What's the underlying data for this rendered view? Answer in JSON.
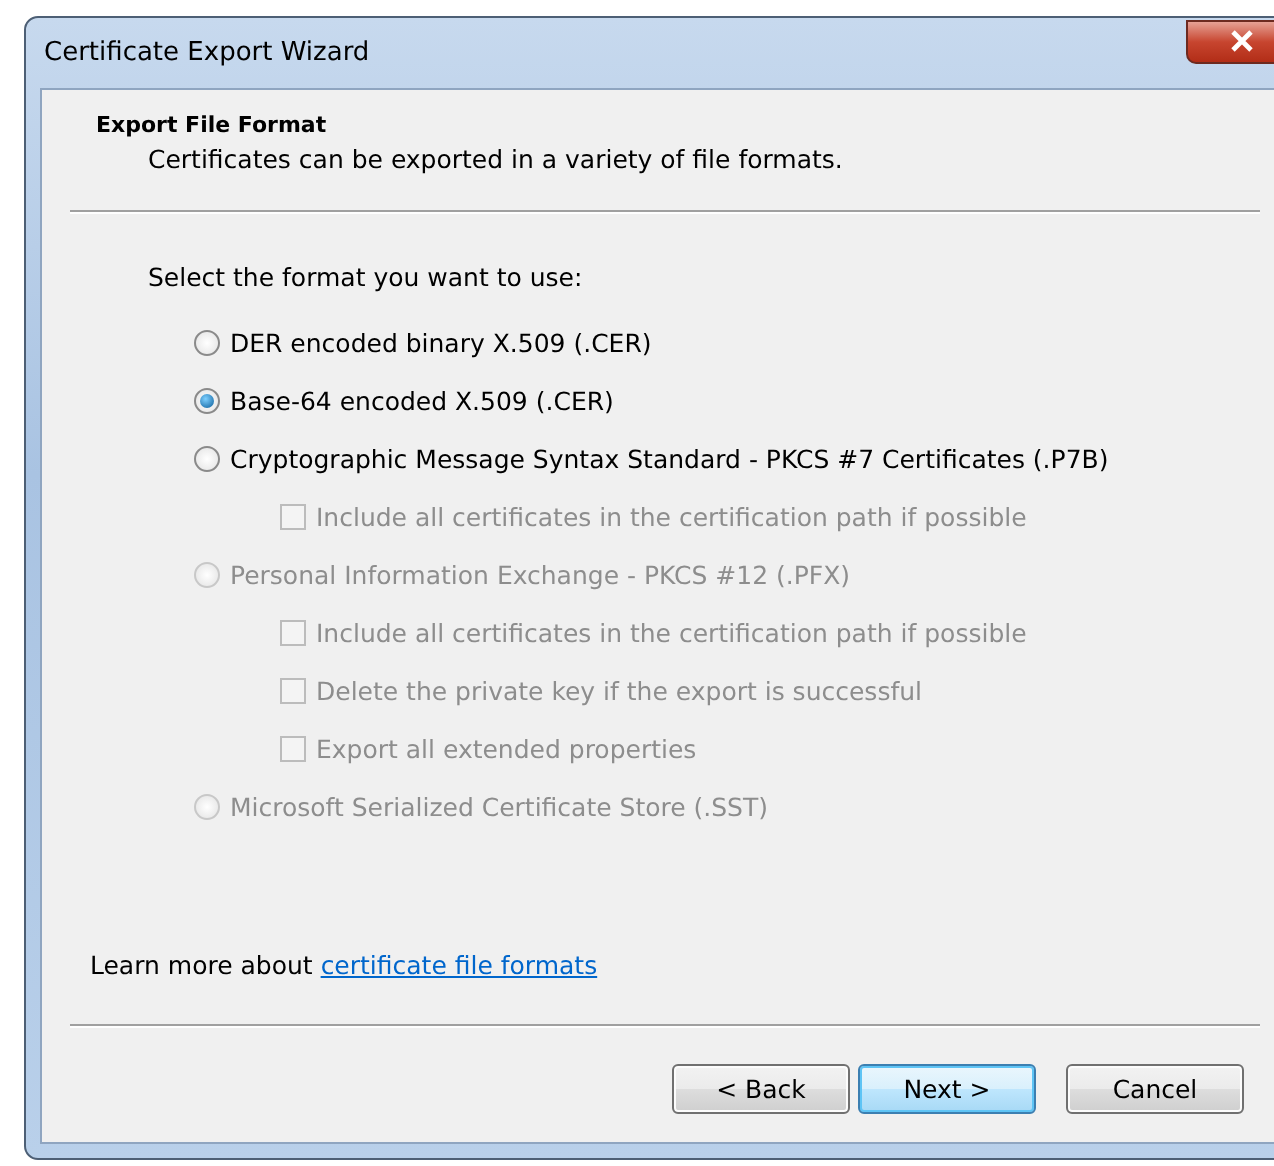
{
  "window": {
    "title": "Certificate Export Wizard"
  },
  "header": {
    "title": "Export File Format",
    "subtitle": "Certificates can be exported in a variety of file formats."
  },
  "prompt": "Select the format you want to use:",
  "options": [
    {
      "kind": "radio",
      "label": "DER encoded binary X.509 (.CER)",
      "selected": false,
      "disabled": false
    },
    {
      "kind": "radio",
      "label": "Base-64 encoded X.509 (.CER)",
      "selected": true,
      "disabled": false
    },
    {
      "kind": "radio",
      "label": "Cryptographic Message Syntax Standard - PKCS #7 Certificates (.P7B)",
      "selected": false,
      "disabled": false,
      "children": [
        {
          "kind": "checkbox",
          "label": "Include all certificates in the certification path if possible",
          "checked": false,
          "disabled": true
        }
      ]
    },
    {
      "kind": "radio",
      "label": "Personal Information Exchange - PKCS #12 (.PFX)",
      "selected": false,
      "disabled": true,
      "children": [
        {
          "kind": "checkbox",
          "label": "Include all certificates in the certification path if possible",
          "checked": false,
          "disabled": true
        },
        {
          "kind": "checkbox",
          "label": "Delete the private key if the export is successful",
          "checked": false,
          "disabled": true
        },
        {
          "kind": "checkbox",
          "label": "Export all extended properties",
          "checked": false,
          "disabled": true
        }
      ]
    },
    {
      "kind": "radio",
      "label": "Microsoft Serialized Certificate Store (.SST)",
      "selected": false,
      "disabled": true
    }
  ],
  "learn_more": {
    "text": "Learn more about",
    "link": "certificate file formats"
  },
  "buttons": [
    {
      "label": "< Back",
      "default": false
    },
    {
      "label": "Next >",
      "default": true
    },
    {
      "label": "Cancel",
      "default": false
    }
  ]
}
